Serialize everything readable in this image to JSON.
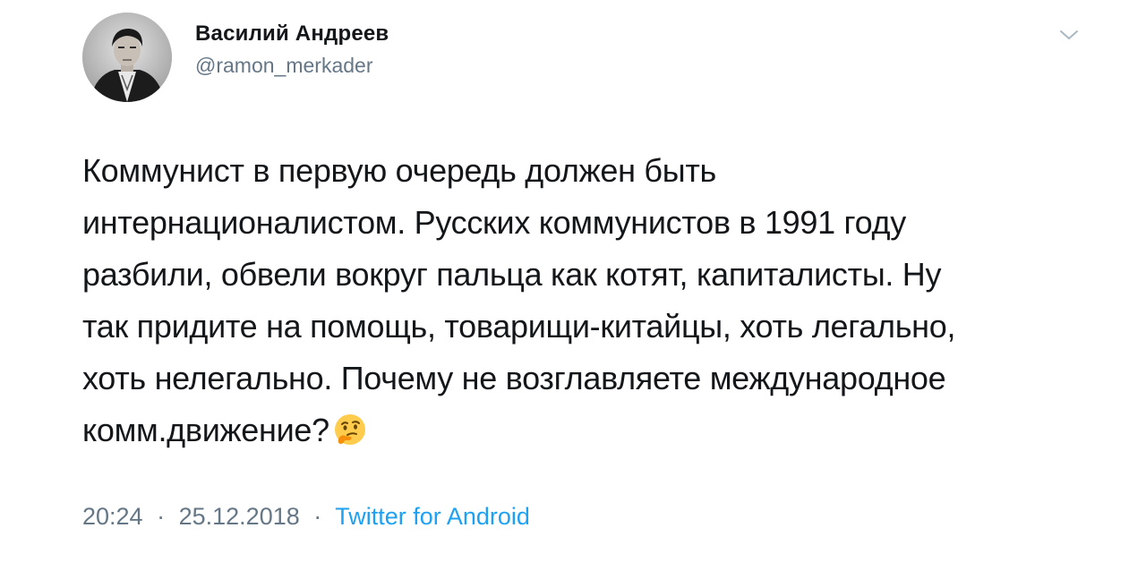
{
  "user": {
    "display_name": "Василий Андреев",
    "handle": "@ramon_merkader"
  },
  "tweet": {
    "lines": [
      "Коммунист в первую очередь должен быть",
      "интернационалистом. Русских коммунистов в 1991 году",
      "разбили, обвели вокруг пальца как котят, капиталисты. Ну",
      "так придите на помощь, товарищи-китайцы, хоть легально,",
      "хоть нелегально. Почему не возглавляете международное",
      "комм.движение?"
    ],
    "emoji": "thinking-face"
  },
  "meta": {
    "time": "20:24",
    "separator": "·",
    "date": "25.12.2018",
    "source": "Twitter for Android"
  },
  "colors": {
    "text": "#14171a",
    "secondary": "#657786",
    "link": "#1da1f2"
  }
}
